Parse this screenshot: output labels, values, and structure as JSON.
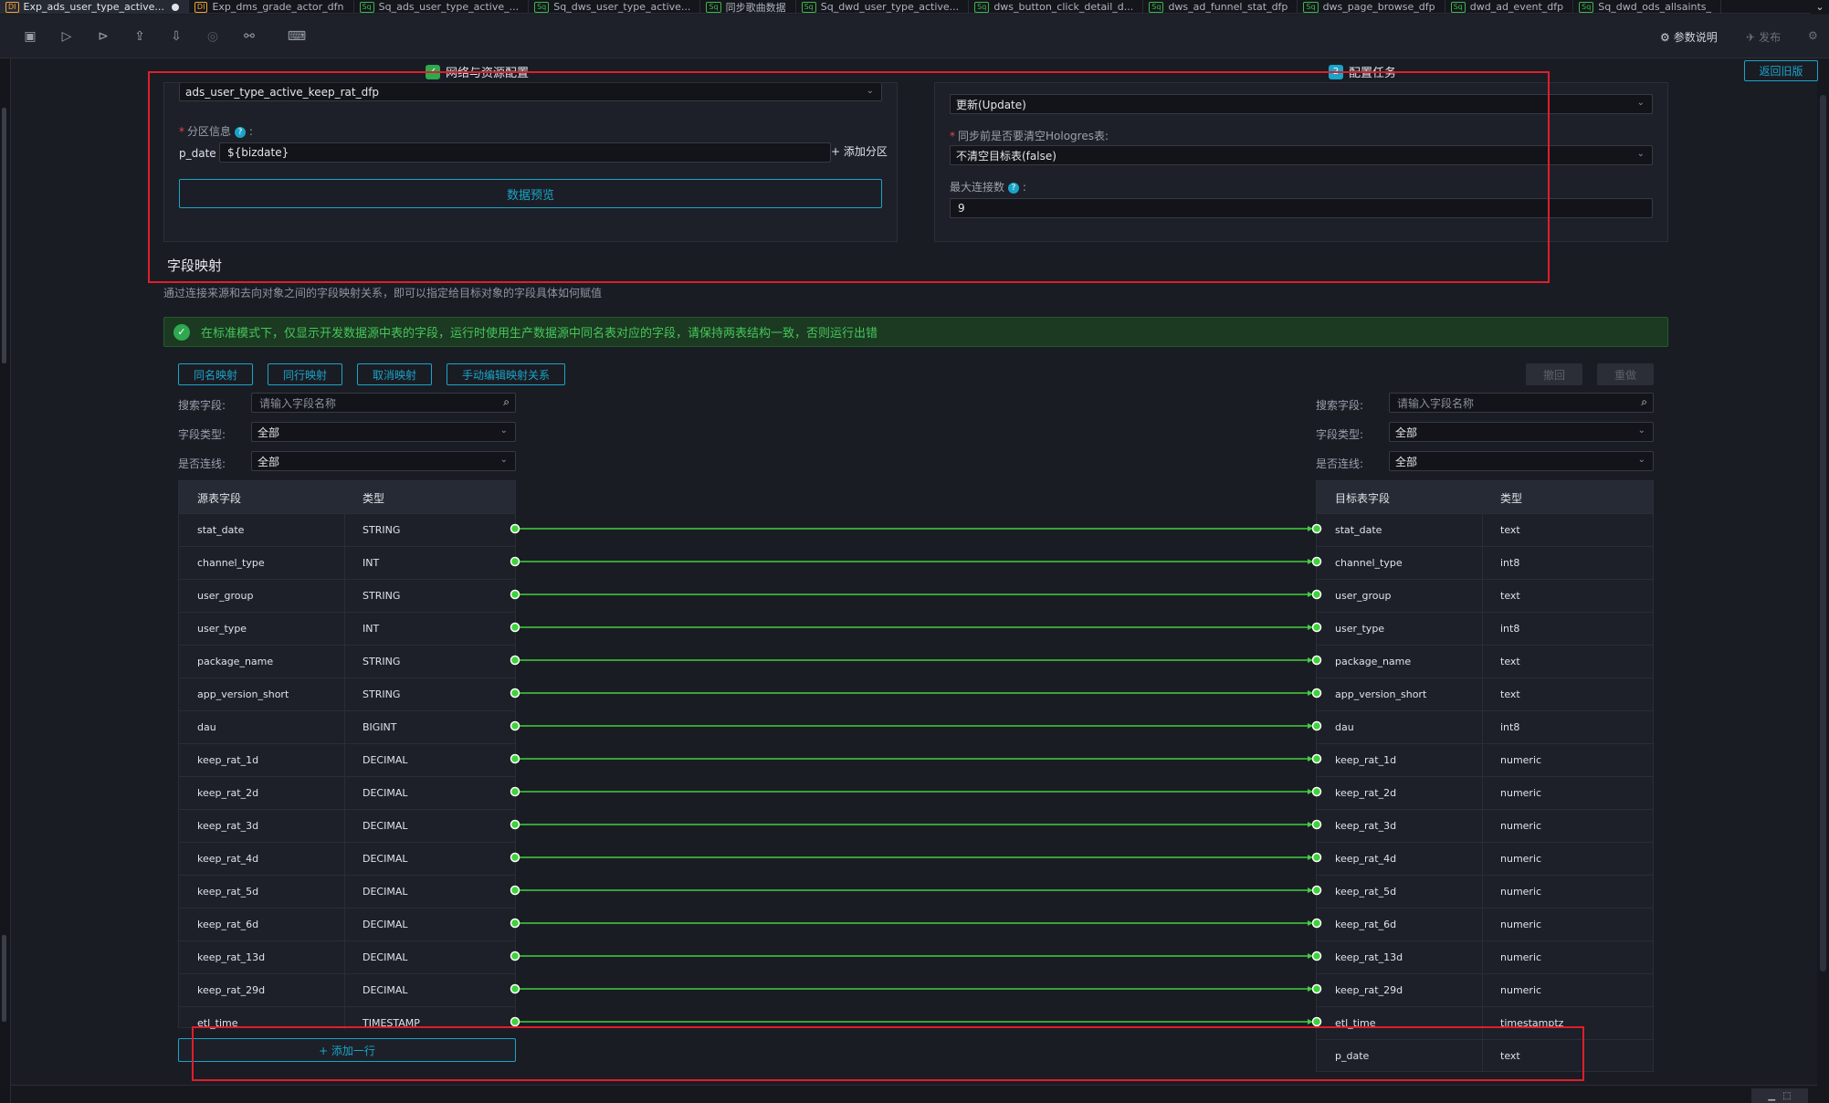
{
  "tabs": [
    {
      "badge": "DI",
      "label": "Exp_ads_user_type_active...",
      "active": true
    },
    {
      "badge": "DI",
      "label": "Exp_dms_grade_actor_dfn",
      "active": false
    },
    {
      "badge": "Sq",
      "label": "Sq_ads_user_type_active_...",
      "active": false
    },
    {
      "badge": "Sq",
      "label": "Sq_dws_user_type_active...",
      "active": false
    },
    {
      "badge": "Sq",
      "label": "同步歌曲数据",
      "active": false
    },
    {
      "badge": "Sq",
      "label": "Sq_dwd_user_type_active...",
      "active": false
    },
    {
      "badge": "Sq",
      "label": "dws_button_click_detail_d...",
      "active": false
    },
    {
      "badge": "Sq",
      "label": "dws_ad_funnel_stat_dfp",
      "active": false
    },
    {
      "badge": "Sq",
      "label": "dws_page_browse_dfp",
      "active": false
    },
    {
      "badge": "Sq",
      "label": "dwd_ad_event_dfp",
      "active": false
    },
    {
      "badge": "Sq",
      "label": "Sq_dwd_ods_allsaints_",
      "active": false
    }
  ],
  "toolbar": {
    "param_label": "参数说明",
    "publish_label": "发布"
  },
  "steps": [
    {
      "num": "",
      "label": "网络与资源配置"
    },
    {
      "num": "2",
      "label": "配置任务"
    }
  ],
  "back_old_label": "返回旧版",
  "source": {
    "table_value": "ads_user_type_active_keep_rat_dfp",
    "partition_label": "分区信息",
    "partition_key": "p_date =",
    "partition_value": "${bizdate}",
    "add_partition": "+ 添加分区",
    "preview_label": "数据预览"
  },
  "target": {
    "write_mode_value": "更新(Update)",
    "clear_label": "同步前是否要清空Hologres表:",
    "clear_value": "不清空目标表(false)",
    "maxconn_label": "最大连接数",
    "maxconn_value": "9"
  },
  "mapping": {
    "title": "字段映射",
    "desc": "通过连接来源和去向对象之间的字段映射关系，即可以指定给目标对象的字段具体如何赋值",
    "notice": "在标准模式下，仅显示开发数据源中表的字段，运行时使用生产数据源中同名表对应的字段，请保持两表结构一致，否则运行出错",
    "btn_same_name": "同名映射",
    "btn_same_row": "同行映射",
    "btn_cancel": "取消映射",
    "btn_manual": "手动编辑映射关系",
    "btn_undo": "撤回",
    "btn_redo": "重做",
    "search_label": "搜索字段:",
    "search_placeholder": "请输入字段名称",
    "type_label": "字段类型:",
    "type_value": "全部",
    "connected_label": "是否连线:",
    "connected_value": "全部",
    "src_col_field": "源表字段",
    "src_col_type": "类型",
    "dst_col_field": "目标表字段",
    "dst_col_type": "类型",
    "add_row": "+ 添加一行",
    "source_fields": [
      {
        "name": "stat_date",
        "type": "STRING"
      },
      {
        "name": "channel_type",
        "type": "INT"
      },
      {
        "name": "user_group",
        "type": "STRING"
      },
      {
        "name": "user_type",
        "type": "INT"
      },
      {
        "name": "package_name",
        "type": "STRING"
      },
      {
        "name": "app_version_short",
        "type": "STRING"
      },
      {
        "name": "dau",
        "type": "BIGINT"
      },
      {
        "name": "keep_rat_1d",
        "type": "DECIMAL"
      },
      {
        "name": "keep_rat_2d",
        "type": "DECIMAL"
      },
      {
        "name": "keep_rat_3d",
        "type": "DECIMAL"
      },
      {
        "name": "keep_rat_4d",
        "type": "DECIMAL"
      },
      {
        "name": "keep_rat_5d",
        "type": "DECIMAL"
      },
      {
        "name": "keep_rat_6d",
        "type": "DECIMAL"
      },
      {
        "name": "keep_rat_13d",
        "type": "DECIMAL"
      },
      {
        "name": "keep_rat_29d",
        "type": "DECIMAL"
      },
      {
        "name": "etl_time",
        "type": "TIMESTAMP"
      }
    ],
    "target_fields": [
      {
        "name": "stat_date",
        "type": "text"
      },
      {
        "name": "channel_type",
        "type": "int8"
      },
      {
        "name": "user_group",
        "type": "text"
      },
      {
        "name": "user_type",
        "type": "int8"
      },
      {
        "name": "package_name",
        "type": "text"
      },
      {
        "name": "app_version_short",
        "type": "text"
      },
      {
        "name": "dau",
        "type": "int8"
      },
      {
        "name": "keep_rat_1d",
        "type": "numeric"
      },
      {
        "name": "keep_rat_2d",
        "type": "numeric"
      },
      {
        "name": "keep_rat_3d",
        "type": "numeric"
      },
      {
        "name": "keep_rat_4d",
        "type": "numeric"
      },
      {
        "name": "keep_rat_5d",
        "type": "numeric"
      },
      {
        "name": "keep_rat_6d",
        "type": "numeric"
      },
      {
        "name": "keep_rat_13d",
        "type": "numeric"
      },
      {
        "name": "keep_rat_29d",
        "type": "numeric"
      },
      {
        "name": "etl_time",
        "type": "timestamptz"
      },
      {
        "name": "p_date",
        "type": "text"
      }
    ]
  },
  "colors": {
    "accent": "#1ba4c7",
    "link_line": "#3fd13c",
    "annotation_box": "#e01e2c"
  }
}
